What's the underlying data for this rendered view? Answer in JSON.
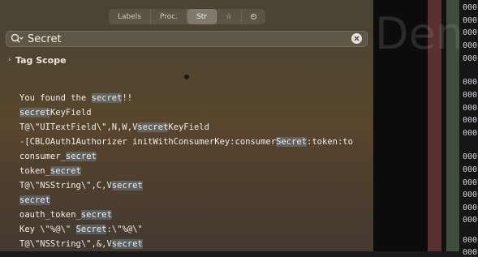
{
  "tabs": [
    {
      "label": "Labels",
      "active": false
    },
    {
      "label": "Proc.",
      "active": false
    },
    {
      "label": "Str",
      "active": true
    },
    {
      "label": "☆",
      "icon": "star-icon",
      "active": false
    },
    {
      "label": "",
      "icon": "circle-dot-icon",
      "active": false
    }
  ],
  "search": {
    "value": "Secret",
    "placeholder": ""
  },
  "tag_scope": {
    "label": "Tag Scope"
  },
  "results": [
    [
      {
        "t": "You found the "
      },
      {
        "t": "secret",
        "hl": true
      },
      {
        "t": "!!"
      }
    ],
    [
      {
        "t": "secret",
        "hl": true
      },
      {
        "t": "KeyField"
      }
    ],
    [
      {
        "t": "T@\\\"UITextField\\\",N,W,V"
      },
      {
        "t": "secret",
        "hl": true
      },
      {
        "t": "KeyField"
      }
    ],
    [
      {
        "t": "-[CBLOAuth1Authorizer initWithConsumerKey:consumer"
      },
      {
        "t": "Secret",
        "hl": true
      },
      {
        "t": ":token:to"
      }
    ],
    [
      {
        "t": "consumer_"
      },
      {
        "t": "secret",
        "hl": true
      }
    ],
    [
      {
        "t": "token_"
      },
      {
        "t": "secret",
        "hl": true
      }
    ],
    [
      {
        "t": "T@\\\"NSString\\\",C,V"
      },
      {
        "t": "secret",
        "hl": true
      }
    ],
    [
      {
        "t": "secret",
        "hl": true
      }
    ],
    [
      {
        "t": "oauth_token_"
      },
      {
        "t": "secret",
        "hl": true
      }
    ],
    [
      {
        "t": "Key \\\"%@\\\" "
      },
      {
        "t": "Secret",
        "hl": true
      },
      {
        "t": ":\\\"%@\\\""
      }
    ],
    [
      {
        "t": "T@\\\"NSString\\\",&,V"
      },
      {
        "t": "secret",
        "hl": true
      }
    ]
  ],
  "background_title": "Den",
  "address_fragments": [
    {
      "text": "000"
    },
    {
      "text": "000"
    },
    {
      "text": "000"
    },
    {
      "text": "000"
    },
    {
      "text": "000"
    },
    {
      "text": "000"
    },
    {
      "text": "000"
    },
    {
      "text": "000"
    },
    {
      "text": "000"
    },
    {
      "text": "000"
    },
    {
      "text": "000"
    },
    {
      "text": "000"
    },
    {
      "text": "000"
    },
    {
      "text": "000"
    },
    {
      "text": "000"
    },
    {
      "text": "000"
    },
    {
      "text": "000"
    },
    {
      "text": "000"
    }
  ],
  "colors": {
    "highlight": "#5b7690",
    "panel": "#53462e",
    "red_column": "#5a3030",
    "green_column": "#3f4d3b"
  }
}
